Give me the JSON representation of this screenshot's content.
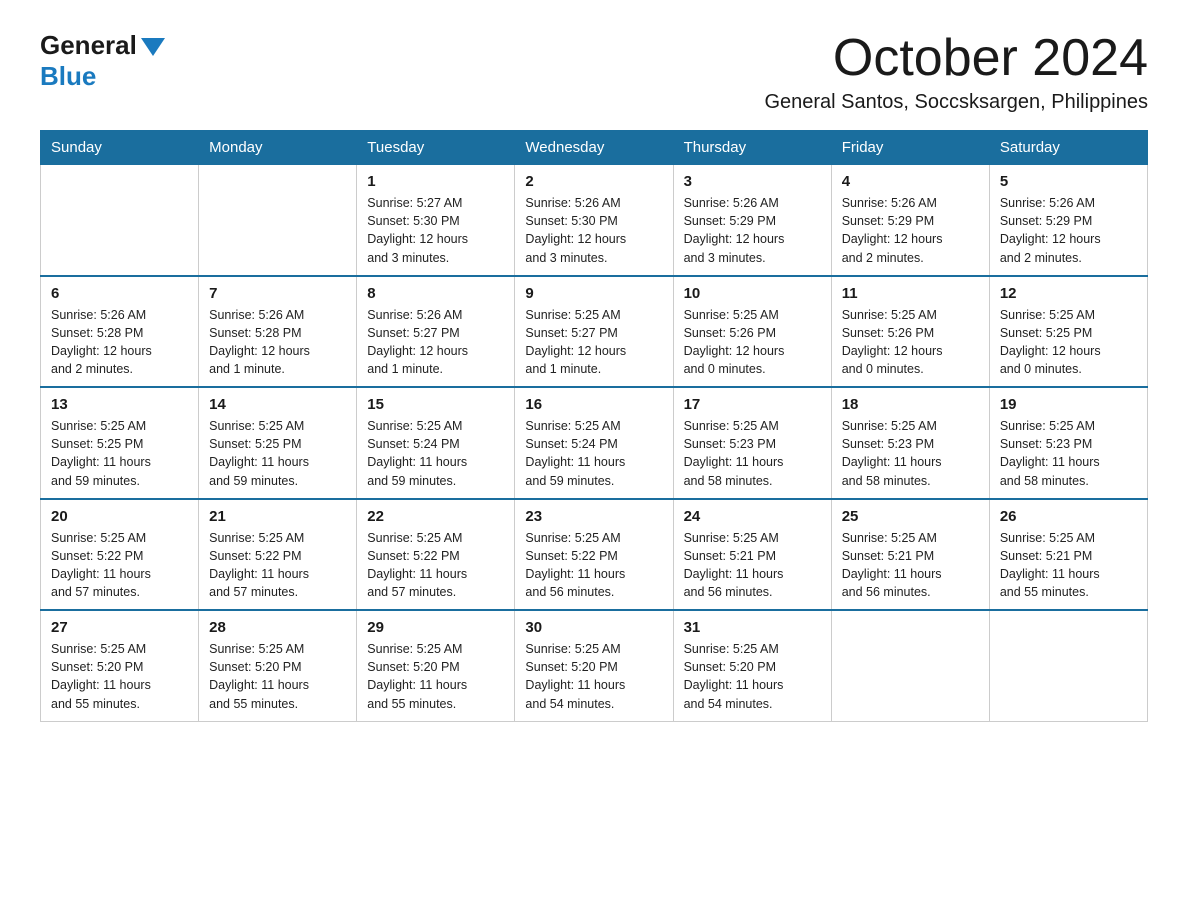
{
  "logo": {
    "general": "General",
    "blue": "Blue"
  },
  "title": "October 2024",
  "subtitle": "General Santos, Soccsksargen, Philippines",
  "headers": [
    "Sunday",
    "Monday",
    "Tuesday",
    "Wednesday",
    "Thursday",
    "Friday",
    "Saturday"
  ],
  "weeks": [
    [
      {
        "day": "",
        "info": ""
      },
      {
        "day": "",
        "info": ""
      },
      {
        "day": "1",
        "info": "Sunrise: 5:27 AM\nSunset: 5:30 PM\nDaylight: 12 hours\nand 3 minutes."
      },
      {
        "day": "2",
        "info": "Sunrise: 5:26 AM\nSunset: 5:30 PM\nDaylight: 12 hours\nand 3 minutes."
      },
      {
        "day": "3",
        "info": "Sunrise: 5:26 AM\nSunset: 5:29 PM\nDaylight: 12 hours\nand 3 minutes."
      },
      {
        "day": "4",
        "info": "Sunrise: 5:26 AM\nSunset: 5:29 PM\nDaylight: 12 hours\nand 2 minutes."
      },
      {
        "day": "5",
        "info": "Sunrise: 5:26 AM\nSunset: 5:29 PM\nDaylight: 12 hours\nand 2 minutes."
      }
    ],
    [
      {
        "day": "6",
        "info": "Sunrise: 5:26 AM\nSunset: 5:28 PM\nDaylight: 12 hours\nand 2 minutes."
      },
      {
        "day": "7",
        "info": "Sunrise: 5:26 AM\nSunset: 5:28 PM\nDaylight: 12 hours\nand 1 minute."
      },
      {
        "day": "8",
        "info": "Sunrise: 5:26 AM\nSunset: 5:27 PM\nDaylight: 12 hours\nand 1 minute."
      },
      {
        "day": "9",
        "info": "Sunrise: 5:25 AM\nSunset: 5:27 PM\nDaylight: 12 hours\nand 1 minute."
      },
      {
        "day": "10",
        "info": "Sunrise: 5:25 AM\nSunset: 5:26 PM\nDaylight: 12 hours\nand 0 minutes."
      },
      {
        "day": "11",
        "info": "Sunrise: 5:25 AM\nSunset: 5:26 PM\nDaylight: 12 hours\nand 0 minutes."
      },
      {
        "day": "12",
        "info": "Sunrise: 5:25 AM\nSunset: 5:25 PM\nDaylight: 12 hours\nand 0 minutes."
      }
    ],
    [
      {
        "day": "13",
        "info": "Sunrise: 5:25 AM\nSunset: 5:25 PM\nDaylight: 11 hours\nand 59 minutes."
      },
      {
        "day": "14",
        "info": "Sunrise: 5:25 AM\nSunset: 5:25 PM\nDaylight: 11 hours\nand 59 minutes."
      },
      {
        "day": "15",
        "info": "Sunrise: 5:25 AM\nSunset: 5:24 PM\nDaylight: 11 hours\nand 59 minutes."
      },
      {
        "day": "16",
        "info": "Sunrise: 5:25 AM\nSunset: 5:24 PM\nDaylight: 11 hours\nand 59 minutes."
      },
      {
        "day": "17",
        "info": "Sunrise: 5:25 AM\nSunset: 5:23 PM\nDaylight: 11 hours\nand 58 minutes."
      },
      {
        "day": "18",
        "info": "Sunrise: 5:25 AM\nSunset: 5:23 PM\nDaylight: 11 hours\nand 58 minutes."
      },
      {
        "day": "19",
        "info": "Sunrise: 5:25 AM\nSunset: 5:23 PM\nDaylight: 11 hours\nand 58 minutes."
      }
    ],
    [
      {
        "day": "20",
        "info": "Sunrise: 5:25 AM\nSunset: 5:22 PM\nDaylight: 11 hours\nand 57 minutes."
      },
      {
        "day": "21",
        "info": "Sunrise: 5:25 AM\nSunset: 5:22 PM\nDaylight: 11 hours\nand 57 minutes."
      },
      {
        "day": "22",
        "info": "Sunrise: 5:25 AM\nSunset: 5:22 PM\nDaylight: 11 hours\nand 57 minutes."
      },
      {
        "day": "23",
        "info": "Sunrise: 5:25 AM\nSunset: 5:22 PM\nDaylight: 11 hours\nand 56 minutes."
      },
      {
        "day": "24",
        "info": "Sunrise: 5:25 AM\nSunset: 5:21 PM\nDaylight: 11 hours\nand 56 minutes."
      },
      {
        "day": "25",
        "info": "Sunrise: 5:25 AM\nSunset: 5:21 PM\nDaylight: 11 hours\nand 56 minutes."
      },
      {
        "day": "26",
        "info": "Sunrise: 5:25 AM\nSunset: 5:21 PM\nDaylight: 11 hours\nand 55 minutes."
      }
    ],
    [
      {
        "day": "27",
        "info": "Sunrise: 5:25 AM\nSunset: 5:20 PM\nDaylight: 11 hours\nand 55 minutes."
      },
      {
        "day": "28",
        "info": "Sunrise: 5:25 AM\nSunset: 5:20 PM\nDaylight: 11 hours\nand 55 minutes."
      },
      {
        "day": "29",
        "info": "Sunrise: 5:25 AM\nSunset: 5:20 PM\nDaylight: 11 hours\nand 55 minutes."
      },
      {
        "day": "30",
        "info": "Sunrise: 5:25 AM\nSunset: 5:20 PM\nDaylight: 11 hours\nand 54 minutes."
      },
      {
        "day": "31",
        "info": "Sunrise: 5:25 AM\nSunset: 5:20 PM\nDaylight: 11 hours\nand 54 minutes."
      },
      {
        "day": "",
        "info": ""
      },
      {
        "day": "",
        "info": ""
      }
    ]
  ]
}
